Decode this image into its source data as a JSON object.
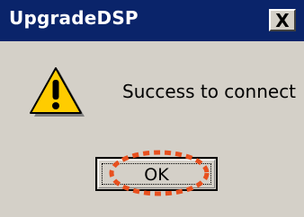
{
  "window": {
    "title": "UpgradeDSP",
    "close_label": "X"
  },
  "body": {
    "icon": "warning-triangle-icon",
    "message": "Success to connect"
  },
  "buttons": {
    "ok_label": "OK"
  },
  "colors": {
    "titlebar": "#0a246a",
    "dialog_bg": "#d4d0c8",
    "highlight": "#e8501e",
    "warning_fill": "#ffcc00"
  }
}
